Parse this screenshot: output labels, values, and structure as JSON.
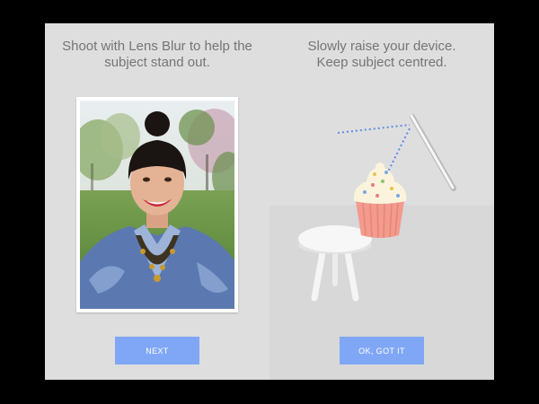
{
  "tutorial": {
    "left": {
      "instruction": "Shoot with Lens Blur to help the\nsubject stand out.",
      "button_label": "NEXT"
    },
    "right": {
      "instruction": "Slowly raise your device.\nKeep subject centred.",
      "button_label": "OK, GOT IT"
    }
  },
  "colors": {
    "screen_bg": "#dedede",
    "button": "#7fa7f6",
    "text": "#757575",
    "motion_dots": "#5b8de8"
  }
}
